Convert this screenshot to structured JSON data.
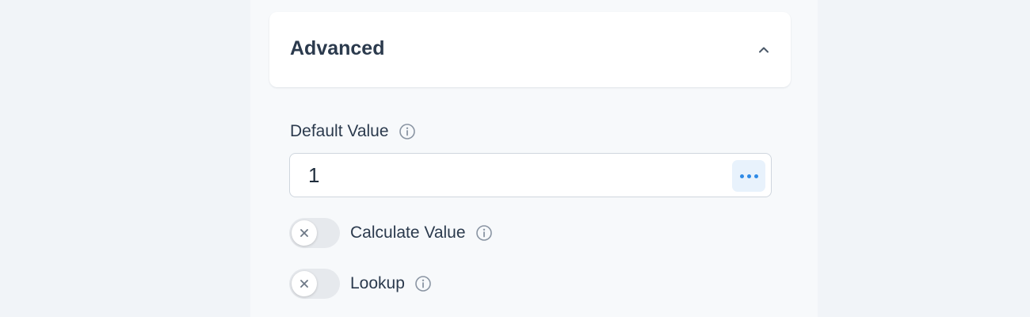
{
  "section": {
    "title": "Advanced",
    "toggle_icon": "chevron-up-icon"
  },
  "default_value": {
    "label": "Default Value",
    "value": "1",
    "info_icon": "info-icon",
    "more_button_icon": "more-horizontal-icon"
  },
  "toggles": [
    {
      "label": "Calculate Value",
      "enabled": false
    },
    {
      "label": "Lookup",
      "enabled": false
    }
  ],
  "colors": {
    "accent": "#2e8ae6",
    "accent_bg": "#e8f2fc",
    "text": "#2b3a4d",
    "toggle_off": "#e6e9ed"
  }
}
